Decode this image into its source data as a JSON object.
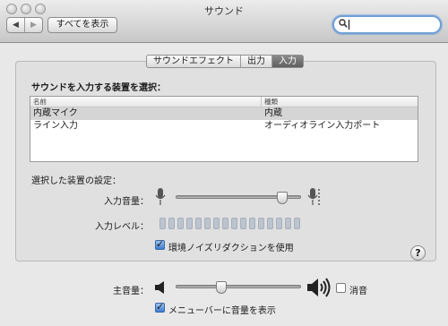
{
  "window": {
    "title": "サウンド"
  },
  "toolbar": {
    "back_label": "◀",
    "forward_label": "▶",
    "show_all_label": "すべてを表示",
    "search_value": ""
  },
  "tabs": [
    {
      "label": "サウンドエフェクト",
      "selected": false
    },
    {
      "label": "出力",
      "selected": false
    },
    {
      "label": "入力",
      "selected": true
    }
  ],
  "input": {
    "device_section_label": "サウンドを入力する装置を選択：",
    "columns": [
      "名前",
      "種類"
    ],
    "devices": [
      {
        "name": "内蔵マイク",
        "type": "内蔵",
        "selected": true
      },
      {
        "name": "ライン入力",
        "type": "オーディオライン入力ポート",
        "selected": false
      }
    ],
    "settings_label": "選択した装置の設定：",
    "volume_label": "入力音量：",
    "input_volume": 0.88,
    "level_label": "入力レベル：",
    "level_segments_lit": 0,
    "noise_reduction_label": "環境ノイズリダクションを使用",
    "noise_reduction_checked": true
  },
  "help_label": "?",
  "master": {
    "label": "主音量：",
    "volume": 0.35,
    "mute_label": "消音",
    "mute_checked": false,
    "menubar_label": "メニューバーに音量を表示",
    "menubar_checked": true
  },
  "colors": {
    "selection_gray": "#d5d5d5",
    "focus_blue": "#6e9fd8",
    "checkbox_blue": "#3f7bd0"
  }
}
